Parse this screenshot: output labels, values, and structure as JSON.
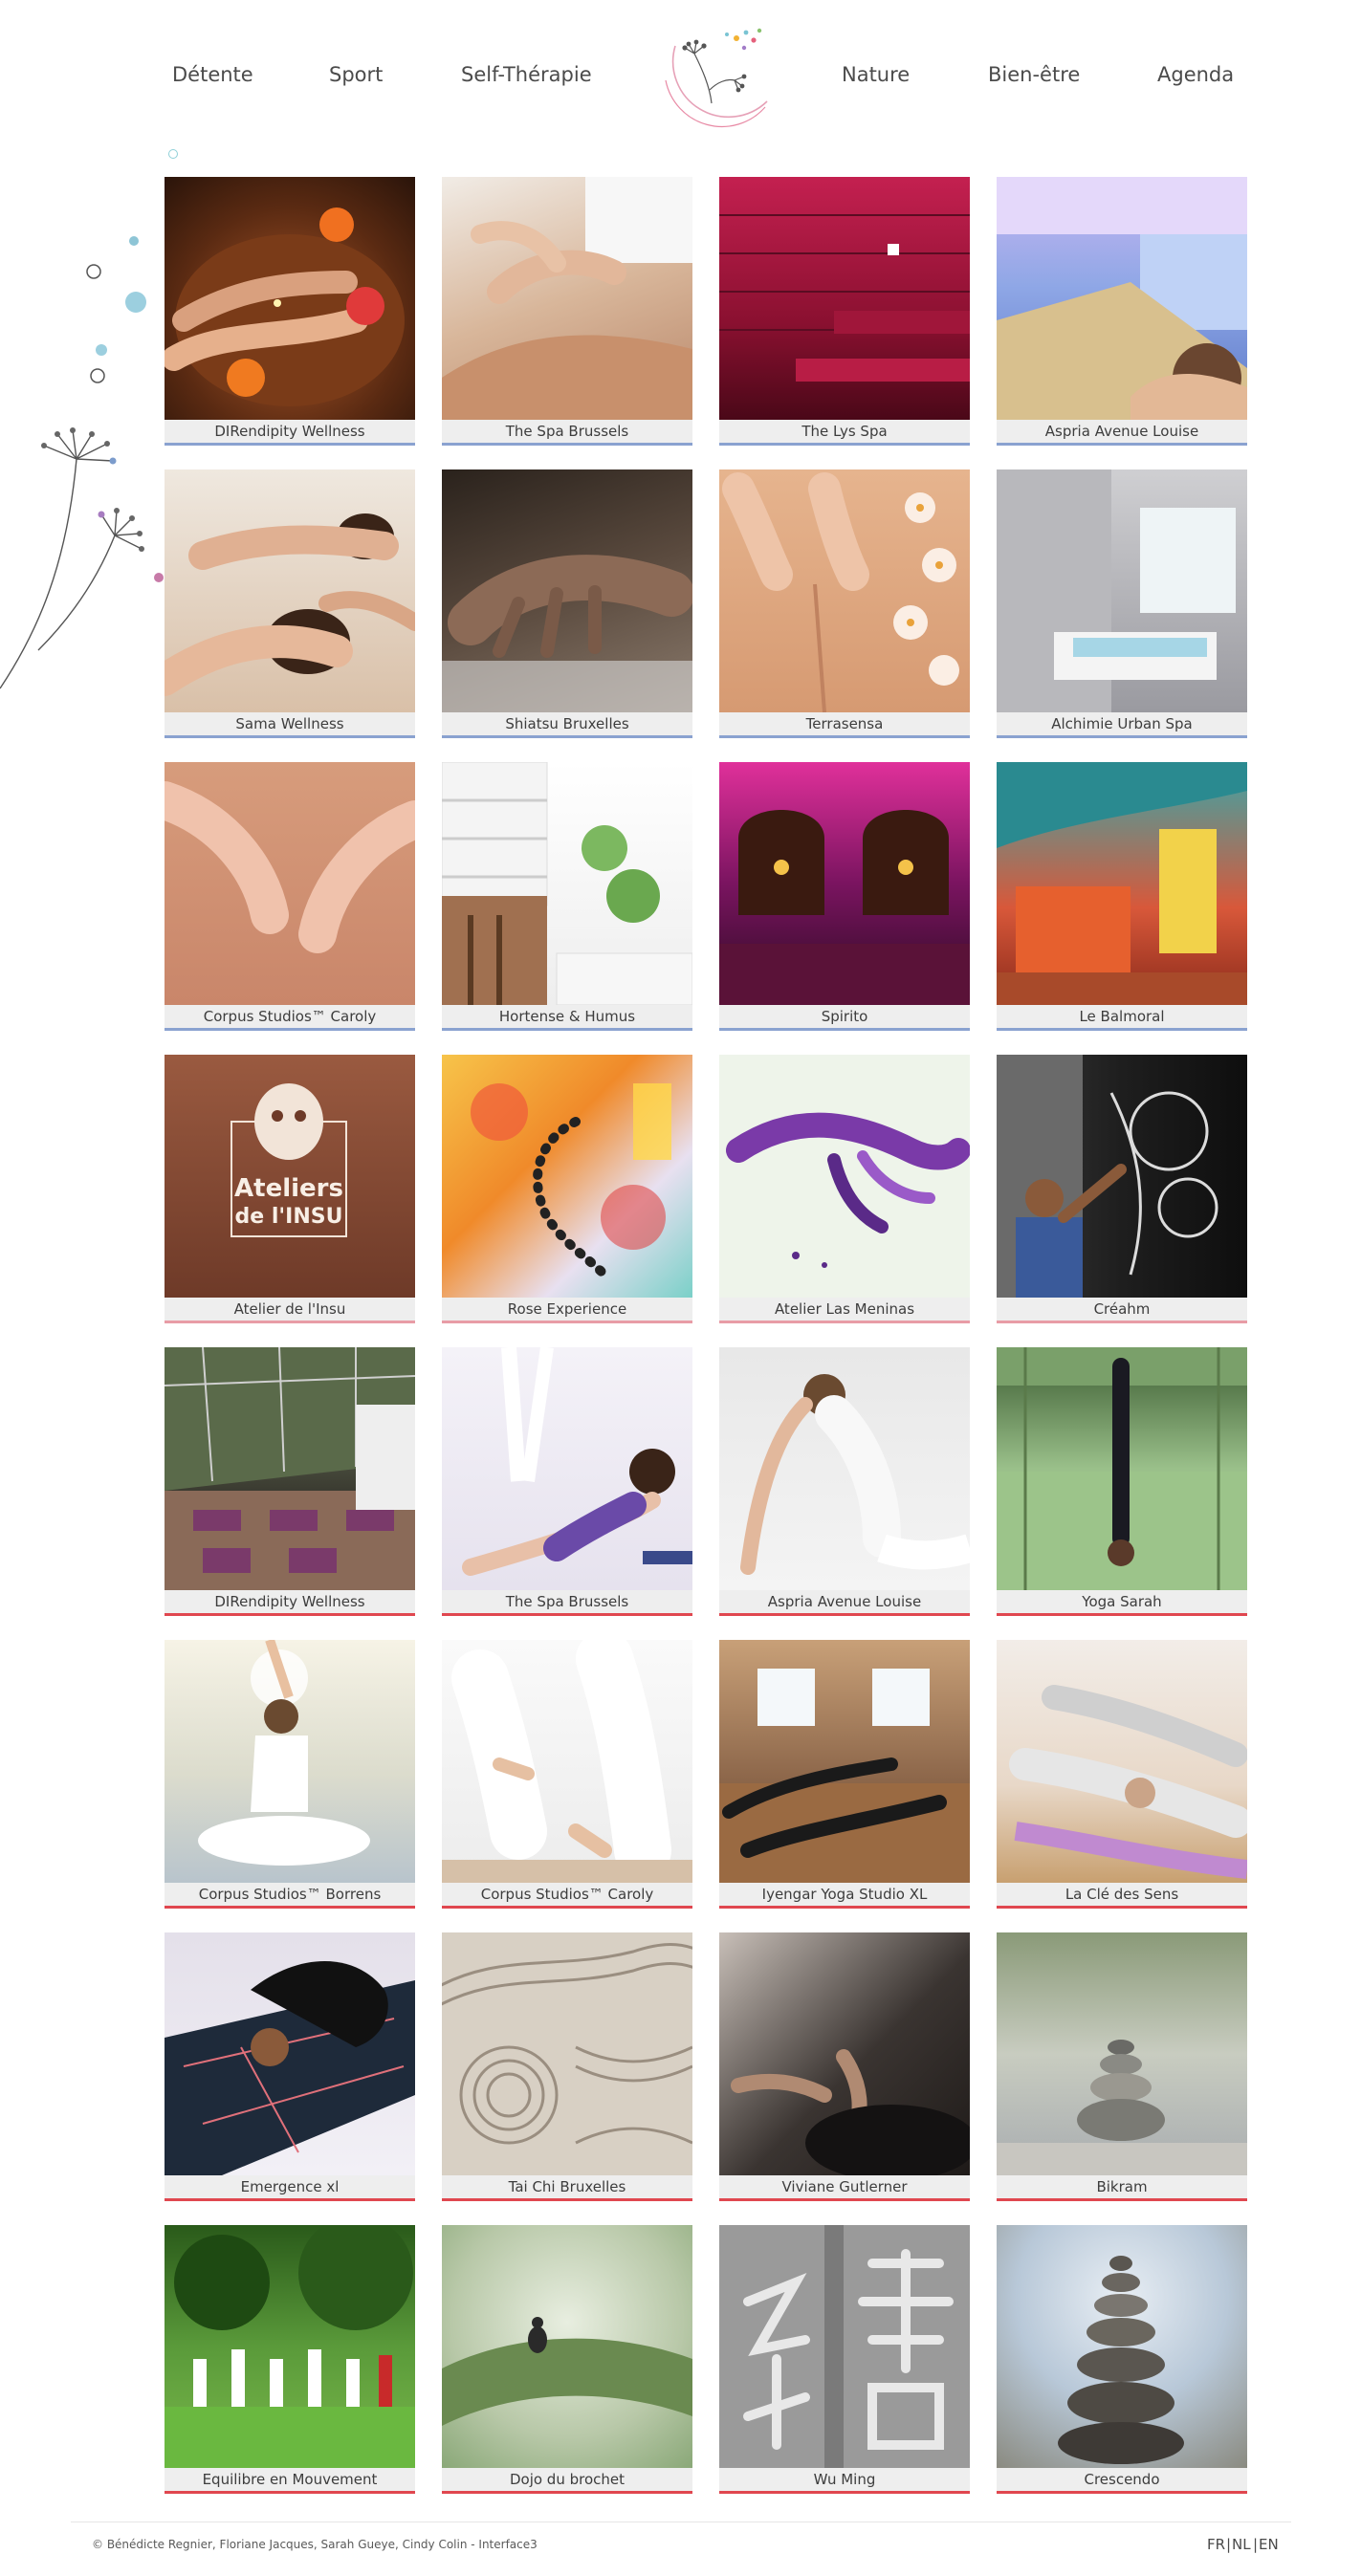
{
  "nav": {
    "items": [
      {
        "label": "Détente"
      },
      {
        "label": "Sport"
      },
      {
        "label": "Self-Thérapie"
      },
      {
        "label": "Nature"
      },
      {
        "label": "Bien-être"
      },
      {
        "label": "Agenda"
      }
    ]
  },
  "colors": {
    "detente_underline": "#8aa2d0",
    "selftherapie_underline": "#e89ca6",
    "sport_underline": "#e0474f"
  },
  "cards": [
    {
      "label": "DIRendipity Wellness",
      "icon": "spa-foot-bath-photo"
    },
    {
      "label": "The Spa Brussels",
      "icon": "massage-photo"
    },
    {
      "label": "The Lys Spa",
      "icon": "sauna-photo"
    },
    {
      "label": "Aspria Avenue Louise",
      "icon": "pool-photo"
    },
    {
      "label": "Sama Wellness",
      "icon": "couple-massage-photo"
    },
    {
      "label": "Shiatsu Bruxelles",
      "icon": "hand-photo"
    },
    {
      "label": "Terrasensa",
      "icon": "back-massage-photo"
    },
    {
      "label": "Alchimie Urban Spa",
      "icon": "jacuzzi-photo"
    },
    {
      "label": "Corpus Studios™ Caroly",
      "icon": "hands-photo"
    },
    {
      "label": "Hortense & Humus",
      "icon": "kitchen-photo"
    },
    {
      "label": "Spirito",
      "icon": "bar-photo"
    },
    {
      "label": "Le Balmoral",
      "icon": "diner-photo"
    },
    {
      "label": "Atelier de l'Insu",
      "icon": "cave-art-photo"
    },
    {
      "label": "Rose Experience",
      "icon": "watercolor-photo"
    },
    {
      "label": "Atelier Las Meninas",
      "icon": "ink-painting-photo"
    },
    {
      "label": "Créahm",
      "icon": "artist-painting-photo"
    },
    {
      "label": "DIRendipity Wellness",
      "icon": "yoga-room-photo"
    },
    {
      "label": "The Spa Brussels",
      "icon": "aerial-yoga-photo"
    },
    {
      "label": "Aspria Avenue Louise",
      "icon": "yoga-pose-photo"
    },
    {
      "label": "Yoga Sarah",
      "icon": "headstand-photo"
    },
    {
      "label": "Corpus Studios™ Borrens",
      "icon": "meditation-photo"
    },
    {
      "label": "Corpus Studios™ Caroly",
      "icon": "meditation-group-photo"
    },
    {
      "label": "Iyengar Yoga Studio XL",
      "icon": "yoga-class-photo"
    },
    {
      "label": "La Clé des Sens",
      "icon": "child-pose-photo"
    },
    {
      "label": "Emergence xl",
      "icon": "yoga-mat-photo"
    },
    {
      "label": "Tai Chi Bruxelles",
      "icon": "zen-sand-photo"
    },
    {
      "label": "Viviane Gutlerner",
      "icon": "lotus-hands-photo"
    },
    {
      "label": "Bikram",
      "icon": "stones-photo"
    },
    {
      "label": "Equilibre en Mouvement",
      "icon": "tai-chi-park-photo"
    },
    {
      "label": "Dojo du brochet",
      "icon": "leaf-statue-photo"
    },
    {
      "label": "Wu Ming",
      "icon": "calligraphy-photo"
    },
    {
      "label": "Crescendo",
      "icon": "stone-stack-photo"
    }
  ],
  "footer": {
    "credit": "© Bénédicte Regnier, Floriane Jacques, Sarah Gueye, Cindy Colin - Interface3",
    "lang": {
      "fr": "FR",
      "nl": "NL",
      "en": "EN"
    }
  }
}
